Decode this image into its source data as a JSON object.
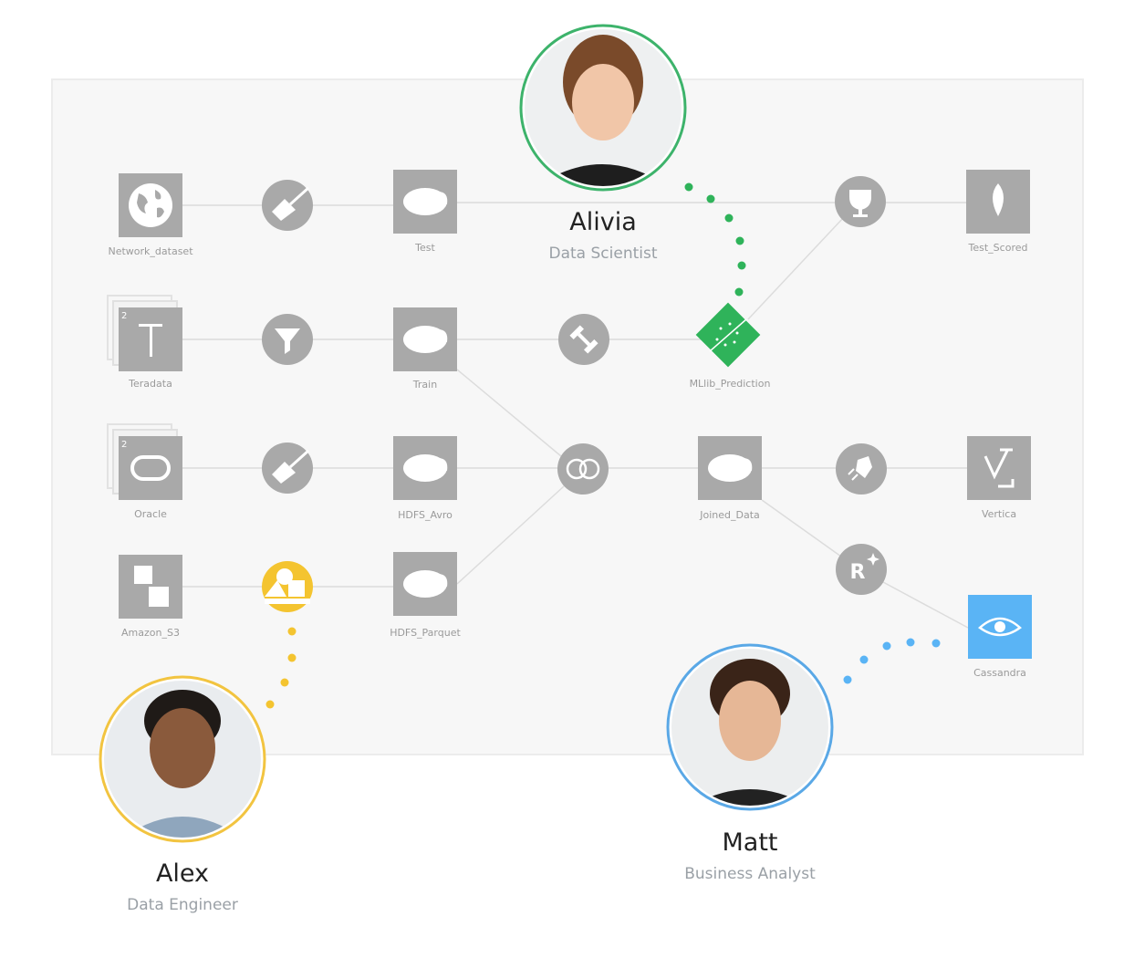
{
  "nodes": {
    "network_dataset": "Network_dataset",
    "test": "Test",
    "test_scored": "Test_Scored",
    "teradata": "Teradata",
    "train": "Train",
    "mllib_prediction": "MLlib_Prediction",
    "oracle": "Oracle",
    "hdfs_avro": "HDFS_Avro",
    "joined_data": "Joined_Data",
    "vertica": "Vertica",
    "amazon_s3": "Amazon_S3",
    "hdfs_parquet": "HDFS_Parquet",
    "cassandra": "Cassandra",
    "stack_count": "2",
    "r_badge": "R"
  },
  "people": [
    {
      "name": "Alivia",
      "role": "Data Scientist",
      "color": "#3db36b"
    },
    {
      "name": "Alex",
      "role": "Data Engineer",
      "color": "#f2c440"
    },
    {
      "name": "Matt",
      "role": "Business Analyst",
      "color": "#5aa8e6"
    }
  ],
  "colors": {
    "node": "#a9a9a9",
    "edge": "#dcdcdc",
    "ml_model": "#2fb35a",
    "active_recipe": "#f4c430",
    "cassandra": "#5ab4f5"
  }
}
